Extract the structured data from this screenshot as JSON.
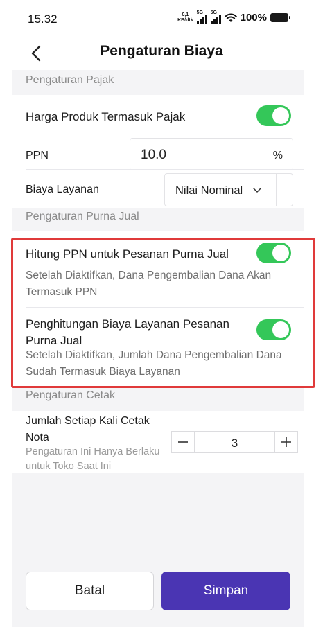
{
  "status_bar": {
    "time": "15.32",
    "net_speed_value": "0,1",
    "net_speed_unit": "KB/dtk",
    "signal1": "5G",
    "signal2": "5G",
    "battery": "100%"
  },
  "header": {
    "title": "Pengaturan Biaya"
  },
  "tax_section": {
    "title": "Pengaturan Pajak",
    "price_includes_tax": {
      "label": "Harga Produk Termasuk Pajak",
      "enabled": true
    },
    "ppn": {
      "label": "PPN",
      "value": "10.0",
      "unit": "%"
    },
    "service_fee": {
      "label": "Biaya Layanan",
      "selected": "Nilai Nominal"
    }
  },
  "after_sales_section": {
    "title": "Pengaturan Purna Jual",
    "calc_ppn": {
      "label": "Hitung PPN untuk Pesanan Purna Jual",
      "enabled": true,
      "description": "Setelah Diaktifkan, Dana Pengembalian Dana Akan Termasuk PPN"
    },
    "calc_service_fee": {
      "label": "Penghitungan Biaya Layanan Pesanan Purna Jual",
      "enabled": true,
      "description": "Setelah Diaktifkan, Jumlah Dana Pengembalian Dana Sudah Termasuk Biaya Layanan"
    }
  },
  "print_section": {
    "title": "Pengaturan Cetak",
    "print_count": {
      "label": "Jumlah Setiap Kali Cetak Nota",
      "note": "Pengaturan Ini Hanya Berlaku untuk Toko Saat Ini",
      "value": "3"
    }
  },
  "footer": {
    "cancel_label": "Batal",
    "save_label": "Simpan"
  },
  "colors": {
    "toggle_on": "#34c759",
    "primary": "#4a35b3",
    "highlight": "#e03a3a"
  }
}
